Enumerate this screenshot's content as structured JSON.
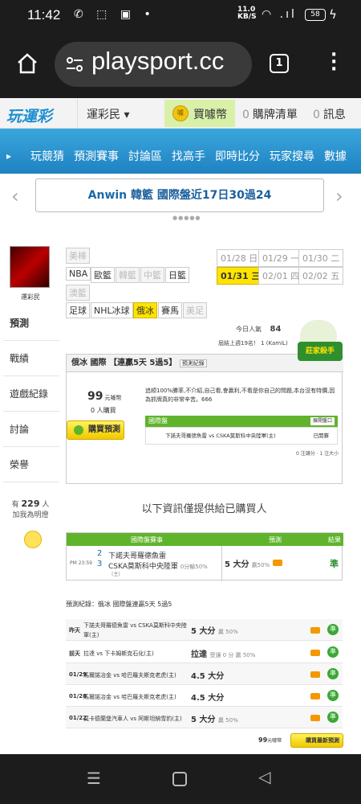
{
  "status": {
    "time": "11:42",
    "speed": "11.0",
    "speed_unit": "KB/S",
    "battery": "58"
  },
  "browser": {
    "url": "playsport.cc",
    "tab_count": "1"
  },
  "nav": {
    "logo": "玩運彩",
    "user": "運彩民 ▾",
    "buy_coin": "買噱幣",
    "cart_count": "0",
    "cart_label": "購牌清單",
    "msg_count": "0",
    "msg_label": "訊息"
  },
  "menu": [
    "玩競猜",
    "預測賽事",
    "討論區",
    "找高手",
    "即時比分",
    "玩家搜尋",
    "數據"
  ],
  "banner": {
    "brand": "Anwin",
    "text": "韓籃 國際盤近17日30過24"
  },
  "sidebar": {
    "name": "運彩民",
    "items": [
      "預測",
      "戰績",
      "遊戲紀錄",
      "討論",
      "榮譽"
    ],
    "buyers_prefix": "有",
    "buyers_count": "229",
    "buyers_suffix": "人",
    "buyers_line2": "加我為明燈"
  },
  "sports": {
    "row1": [
      {
        "label": "美棒",
        "dim": true
      }
    ],
    "row2": [
      {
        "label": "NBA"
      },
      {
        "label": "歐籃"
      },
      {
        "label": "韓籃",
        "dim": true
      },
      {
        "label": "中籃",
        "dim": true
      },
      {
        "label": "日籃"
      }
    ],
    "row3": [
      {
        "label": "澳籃",
        "dim": true
      }
    ],
    "row4": [
      {
        "label": "足球"
      },
      {
        "label": "NHL冰球"
      },
      {
        "label": "俄冰",
        "sel": true
      },
      {
        "label": "賽馬"
      },
      {
        "label": "美足",
        "dim": true
      }
    ]
  },
  "dates": {
    "row1": [
      {
        "d": "01/28",
        "w": "日"
      },
      {
        "d": "01/29",
        "w": "一"
      },
      {
        "d": "01/30",
        "w": "二"
      }
    ],
    "row2": [
      {
        "d": "01/31",
        "w": "三",
        "sel": true
      },
      {
        "d": "02/01",
        "w": "四"
      },
      {
        "d": "02/02",
        "w": "五"
      }
    ]
  },
  "stats": {
    "popularity_label": "今日人氣",
    "popularity": "84",
    "last_week": "屆結上週19名！ 1 (KamiL)"
  },
  "panel": {
    "title": "俄冰 國際 【連贏5天 5過5】",
    "title_tag": "預測紀錄",
    "price": "99",
    "price_unit": "元噱幣",
    "buyers": "0 人購買",
    "buy_button": "購買預測",
    "desc": "追顺100%勝率,不介紹,自己看,會贏利,不看是你自己的問題,本台沒有特價,因為抓牌真的非常辛苦。666",
    "game_label": "國際盤",
    "game_btn": "展開盤口",
    "game_match": "下諾夫哥羅德魚雷 vs CSKA莫斯科中央陸軍(主)",
    "game_status": "已開賽",
    "footer": "0 注讓分 · 1 注大小",
    "champ": "莊家殺手"
  },
  "notice": "以下資訊僅提供給已購買人",
  "table": {
    "headers": [
      "國際盤賽事",
      "預測",
      "結果"
    ],
    "time": "PM 23:59",
    "num1": "2",
    "num2": "3",
    "team1": "下諾夫哥羅德魚雷",
    "team2": "CSKA莫斯科中央陸軍",
    "team2_note": "0分輸50%",
    "home_tag": "(主)",
    "pick": "5 大分",
    "pick_note": "贏50%",
    "result": "準"
  },
  "record": {
    "title": "預測紀錄：俄冰 國際盤連贏5天 5過5",
    "rows": [
      {
        "day": "昨天",
        "match": "下諾夫哥羅德魚雷 vs CSKA莫斯科中央陸軍(主)",
        "pick": "5 大分",
        "note": "贏 50%",
        "res": "準"
      },
      {
        "day": "前天",
        "match": "拉達 vs 下卡姆斯克石化(主)",
        "pick": "拉達",
        "note": "受讓 0 分 贏 50%",
        "res": "準"
      },
      {
        "day": "01/29",
        "match": "馬爾諾冶金 vs 哈巴羅夫斯克老虎(主)",
        "pick": "4.5 大分",
        "note": "",
        "res": "準"
      },
      {
        "day": "01/28",
        "match": "馬爾諾冶金 vs 哈巴羅夫斯克老虎(主)",
        "pick": "4.5 大分",
        "note": "",
        "res": "準"
      },
      {
        "day": "01/22",
        "match": "莫卡德蘭堡汽車人 vs 阿斯坦納雪豹(主)",
        "pick": "5 大分",
        "note": "贏 50%",
        "res": "準"
      }
    ],
    "price": "99",
    "price_unit": "元噱幣",
    "buy_latest": "購買最新預測"
  }
}
